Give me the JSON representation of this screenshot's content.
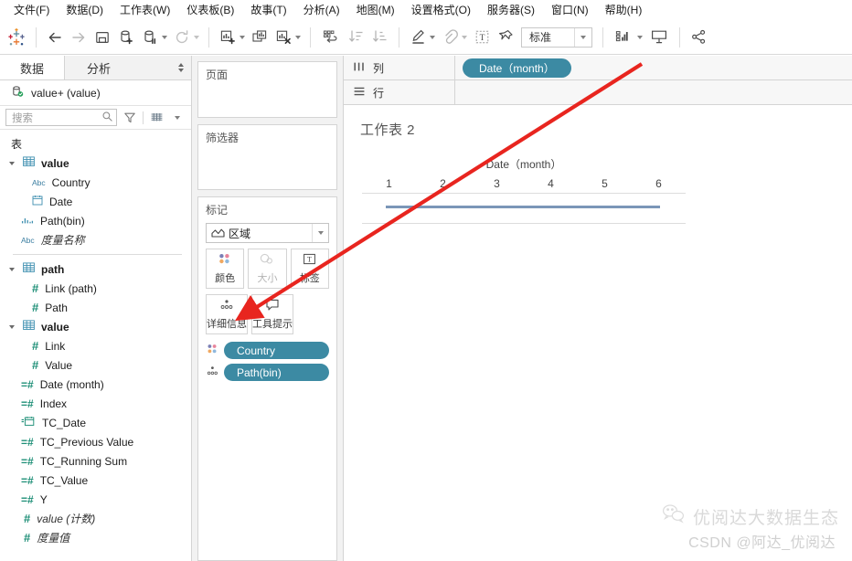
{
  "menubar": {
    "items": [
      {
        "label": "文件(F)"
      },
      {
        "label": "数据(D)"
      },
      {
        "label": "工作表(W)"
      },
      {
        "label": "仪表板(B)"
      },
      {
        "label": "故事(T)"
      },
      {
        "label": "分析(A)"
      },
      {
        "label": "地图(M)"
      },
      {
        "label": "设置格式(O)"
      },
      {
        "label": "服务器(S)"
      },
      {
        "label": "窗口(N)"
      },
      {
        "label": "帮助(H)"
      }
    ]
  },
  "toolbar": {
    "icons": [
      "tableau-logo-icon",
      "back-arrow-icon",
      "forward-arrow-icon",
      "save-icon",
      "new-data-source-icon",
      "pause-data-updates-icon",
      "refresh-data-source-icon",
      "new-worksheet-icon",
      "duplicate-sheet-icon",
      "clear-sheet-icon",
      "swap-rows-columns-icon",
      "sort-ascending-icon",
      "sort-descending-icon",
      "highlight-icon",
      "fix-axes-icon",
      "text-label-icon",
      "pin-icon",
      "show-me-icon",
      "presentation-mode-icon",
      "share-icon"
    ],
    "fit_dropdown_value": "标准"
  },
  "datapane": {
    "tabs": [
      {
        "label": "数据",
        "active": true
      },
      {
        "label": "分析",
        "active": false
      }
    ],
    "connection": "value+ (value)",
    "search_placeholder": "搜索",
    "section_label": "表",
    "groups": [
      {
        "name": "value",
        "icon": "table-icon",
        "expanded": true,
        "fields": [
          {
            "label": "Country",
            "icon": "abc-icon",
            "indent": 2
          },
          {
            "label": "Date",
            "icon": "calendar-icon",
            "indent": 2
          },
          {
            "label": "Path(bin)",
            "icon": "bin-icon",
            "indent": 1
          },
          {
            "label": "度量名称",
            "icon": "abc-icon",
            "indent": 1,
            "italic": true
          }
        ]
      },
      {
        "name": "path",
        "icon": "table-icon",
        "expanded": true,
        "fields": [
          {
            "label": "Link (path)",
            "icon": "number-icon",
            "indent": 2
          },
          {
            "label": "Path",
            "icon": "number-icon",
            "indent": 2
          }
        ]
      },
      {
        "name": "value",
        "icon": "table-icon",
        "expanded": true,
        "fields": [
          {
            "label": "Link",
            "icon": "number-icon",
            "indent": 2
          },
          {
            "label": "Value",
            "icon": "number-icon",
            "indent": 2
          },
          {
            "label": "Date (month)",
            "icon": "calculated-number-icon",
            "indent": 1
          },
          {
            "label": "Index",
            "icon": "calculated-number-icon",
            "indent": 1
          },
          {
            "label": "TC_Date",
            "icon": "calculated-date-icon",
            "indent": 1
          },
          {
            "label": "TC_Previous Value",
            "icon": "calculated-number-icon",
            "indent": 1
          },
          {
            "label": "TC_Running Sum",
            "icon": "calculated-number-icon",
            "indent": 1
          },
          {
            "label": "TC_Value",
            "icon": "calculated-number-icon",
            "indent": 1
          },
          {
            "label": "Y",
            "icon": "calculated-number-icon",
            "indent": 1
          },
          {
            "label": "value (计数)",
            "icon": "number-icon",
            "indent": 1,
            "italic": true
          },
          {
            "label": "度量值",
            "icon": "number-icon",
            "indent": 1,
            "italic": true
          }
        ]
      }
    ]
  },
  "shelfcol": {
    "pages_title": "页面",
    "filters_title": "筛选器",
    "marks_title": "标记",
    "mark_type": "区域",
    "mark_buttons": [
      {
        "label": "颜色",
        "icon": "color-icon",
        "dim": false
      },
      {
        "label": "大小",
        "icon": "size-icon",
        "dim": true
      },
      {
        "label": "标签",
        "icon": "label-icon",
        "dim": false
      },
      {
        "label": "详细信息",
        "icon": "detail-icon",
        "dim": false
      },
      {
        "label": "工具提示",
        "icon": "tooltip-icon",
        "dim": false
      }
    ],
    "mark_pills": [
      {
        "label": "Country",
        "icon": "color-icon"
      },
      {
        "label": "Path(bin)",
        "icon": "detail-icon"
      }
    ]
  },
  "shelves": {
    "columns_label": "列",
    "rows_label": "行",
    "columns_pills": [
      "Date（month）"
    ],
    "rows_pills": []
  },
  "worksheet": {
    "title": "工作表 2"
  },
  "chart_data": {
    "type": "line",
    "title": "工作表 2",
    "xlabel": "Date（month）",
    "ylabel": "",
    "categories": [
      "1",
      "2",
      "3",
      "4",
      "5",
      "6"
    ],
    "tick_labels": [
      "1",
      "2",
      "3",
      "4",
      "5",
      "6"
    ],
    "series": [
      {
        "name": "Country / Path(bin)",
        "values": [
          0,
          0,
          0,
          0,
          0,
          0
        ],
        "color": "#7b96b8"
      }
    ],
    "grid": true,
    "legend": "none",
    "note": "单条水平线标记，跨 month 1 至 6"
  },
  "annotation": {
    "arrow_color": "#e8251f",
    "points_to": "详细信息"
  },
  "watermark": {
    "icon": "wechat-icon",
    "line1": "优阅达大数据生态",
    "line2": "CSDN @阿达_优阅达"
  },
  "colors": {
    "pill_blue": "#3c8aa3",
    "mark_line": "#7b96b8",
    "accent_red": "#e8251f",
    "panel_grey": "#f2f2f2"
  }
}
